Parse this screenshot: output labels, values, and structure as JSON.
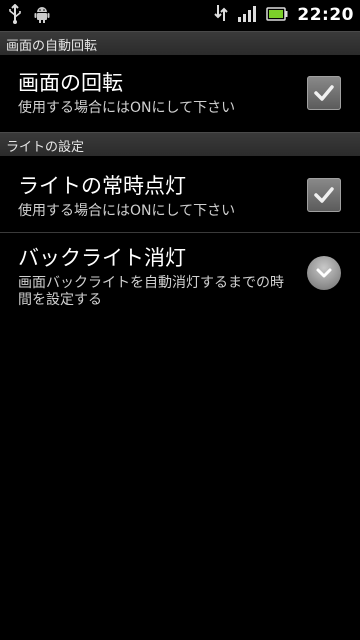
{
  "status_bar": {
    "left_icons": [
      "usb-icon",
      "android-debug-icon"
    ],
    "right_icons": [
      "data-transfer-icon",
      "signal-icon",
      "battery-icon"
    ],
    "time": "22:20"
  },
  "sections": [
    {
      "header": "画面の自動回転",
      "items": [
        {
          "title": "画面の回転",
          "summary": "使用する場合にはONにして下さい",
          "control": "checkbox",
          "checked": true
        }
      ]
    },
    {
      "header": "ライトの設定",
      "items": [
        {
          "title": "ライトの常時点灯",
          "summary": "使用する場合にはONにして下さい",
          "control": "checkbox",
          "checked": true
        },
        {
          "title": "バックライト消灯",
          "summary": "画面バックライトを自動消灯するまでの時間を設定する",
          "control": "dropdown"
        }
      ]
    }
  ],
  "colors": {
    "background": "#000000",
    "section_header": "#2f2f2f",
    "text_primary": "#ffffff",
    "text_secondary": "#d0d0d0"
  }
}
